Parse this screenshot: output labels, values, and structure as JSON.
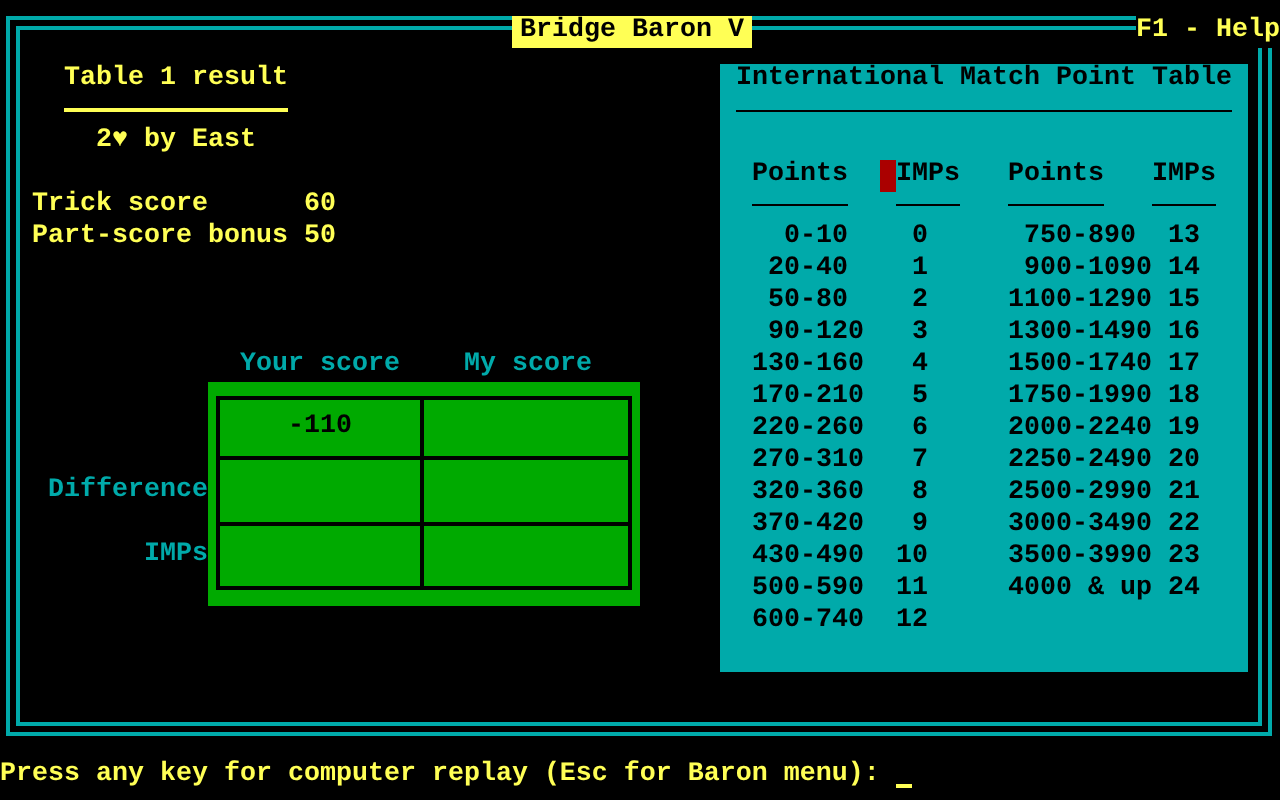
{
  "window": {
    "title": "Bridge Baron V",
    "help": "F1 - Help"
  },
  "result": {
    "title": "Table 1 result",
    "contract": "2♥ by East",
    "scores": [
      {
        "label": "Trick score",
        "value": "60"
      },
      {
        "label": "Part-score bonus",
        "value": "50"
      }
    ]
  },
  "score_grid": {
    "columns": [
      "Your score",
      "My score"
    ],
    "rows": [
      {
        "your_score": "-110"
      },
      {
        "label": "Difference"
      },
      {
        "label": "IMPs"
      }
    ]
  },
  "imp_table": {
    "title": "International Match Point Table",
    "columns": [
      "Points",
      "IMPs",
      "Points",
      "IMPs"
    ],
    "left": [
      {
        "points": "0-10",
        "imps": "0"
      },
      {
        "points": "20-40",
        "imps": "1"
      },
      {
        "points": "50-80",
        "imps": "2"
      },
      {
        "points": "90-120",
        "imps": "3"
      },
      {
        "points": "130-160",
        "imps": "4"
      },
      {
        "points": "170-210",
        "imps": "5"
      },
      {
        "points": "220-260",
        "imps": "6"
      },
      {
        "points": "270-310",
        "imps": "7"
      },
      {
        "points": "320-360",
        "imps": "8"
      },
      {
        "points": "370-420",
        "imps": "9"
      },
      {
        "points": "430-490",
        "imps": "10"
      },
      {
        "points": "500-590",
        "imps": "11"
      },
      {
        "points": "600-740",
        "imps": "12"
      }
    ],
    "right": [
      {
        "points": "750-890",
        "imps": "13"
      },
      {
        "points": "900-1090",
        "imps": "14"
      },
      {
        "points": "1100-1290",
        "imps": "15"
      },
      {
        "points": "1300-1490",
        "imps": "16"
      },
      {
        "points": "1500-1740",
        "imps": "17"
      },
      {
        "points": "1750-1990",
        "imps": "18"
      },
      {
        "points": "2000-2240",
        "imps": "19"
      },
      {
        "points": "2250-2490",
        "imps": "20"
      },
      {
        "points": "2500-2990",
        "imps": "21"
      },
      {
        "points": "3000-3490",
        "imps": "22"
      },
      {
        "points": "3500-3990",
        "imps": "23"
      },
      {
        "points": "4000 & up",
        "imps": "24"
      }
    ]
  },
  "prompt": "Press any key for computer replay (Esc for Baron menu):"
}
